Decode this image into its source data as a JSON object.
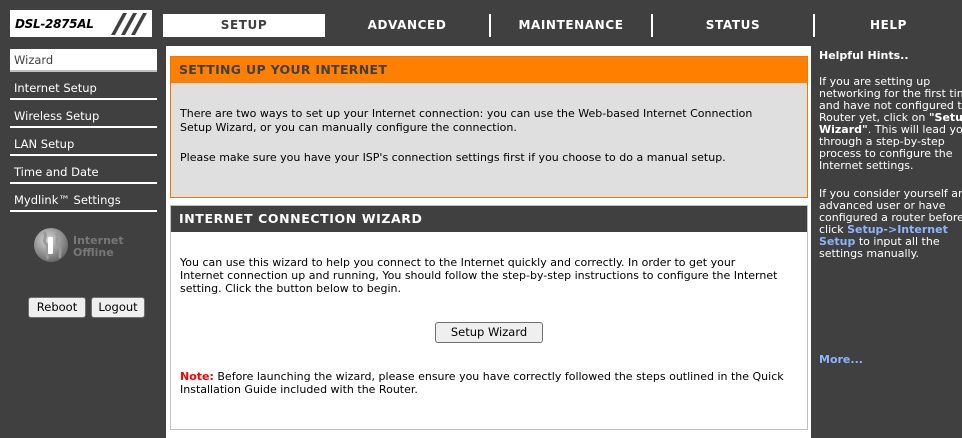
{
  "header": {
    "model": "DSL-2875AL",
    "tabs": [
      {
        "label": "SETUP",
        "active": true
      },
      {
        "label": "ADVANCED",
        "active": false
      },
      {
        "label": "MAINTENANCE",
        "active": false
      },
      {
        "label": "STATUS",
        "active": false
      },
      {
        "label": "HELP",
        "active": false
      }
    ]
  },
  "sidebar": {
    "items": [
      {
        "label": "Wizard",
        "active": true
      },
      {
        "label": "Internet Setup",
        "active": false
      },
      {
        "label": "Wireless Setup",
        "active": false
      },
      {
        "label": "LAN Setup",
        "active": false
      },
      {
        "label": "Time and Date",
        "active": false
      },
      {
        "label": "Mydlink™ Settings",
        "active": false
      }
    ],
    "status": {
      "line1": "Internet",
      "line2": "Offline",
      "icon": "globe-icon"
    },
    "reboot_label": "Reboot",
    "logout_label": "Logout"
  },
  "main": {
    "setup_panel": {
      "title": "SETTING UP YOUR INTERNET",
      "para1_line1": "There are two ways to set up your Internet connection: you can use the Web-based Internet Connection",
      "para1_line2": "Setup Wizard, or you can manually configure the connection.",
      "para2": "Please make sure you have your ISP's connection settings first if you choose to do a manual setup."
    },
    "wizard_panel": {
      "title": "INTERNET CONNECTION WIZARD",
      "line1": "You can use this wizard to help you connect to the Internet quickly and correctly. In order to get your",
      "line2": "Internet connection up and running, You should follow the step-by-step instructions to configure the Internet",
      "line3": "setting. Click the button below to begin.",
      "button_label": "Setup Wizard",
      "note_label": "Note:",
      "note_line1": " Before launching the wizard, please ensure you have correctly followed the steps outlined in the Quick",
      "note_line2": "Installation Guide included with the Router."
    }
  },
  "hints": {
    "title": "Helpful Hints..",
    "h1_l1": "If you are setting up",
    "h1_l2": "networking for the first time",
    "h1_l3": "and have not configured the",
    "h1_l4a": "Router yet, click on ",
    "h1_l4b": "\"Setup",
    "h1_l5a": "Wizard\"",
    "h1_l5b": ". This will lead you",
    "h1_l6": "through a step-by-step",
    "h1_l7": "process to configure the",
    "h1_l8": "Internet settings.",
    "h2_l1": "If you consider yourself an",
    "h2_l2": "advanced user or have",
    "h2_l3": "configured a router before,",
    "h2_l4a": "click ",
    "h2_l4b": "Setup->Internet",
    "h2_l5a": "Setup",
    "h2_l5b": " to input all the",
    "h2_l6": "settings manually.",
    "more_label": "More..."
  },
  "colors": {
    "nav_bg": "#404040",
    "accent_orange": "#ff7f00",
    "panel_gray": "#dfdfdf",
    "link_blue": "#8fb4ff",
    "note_red": "#ff0000"
  }
}
